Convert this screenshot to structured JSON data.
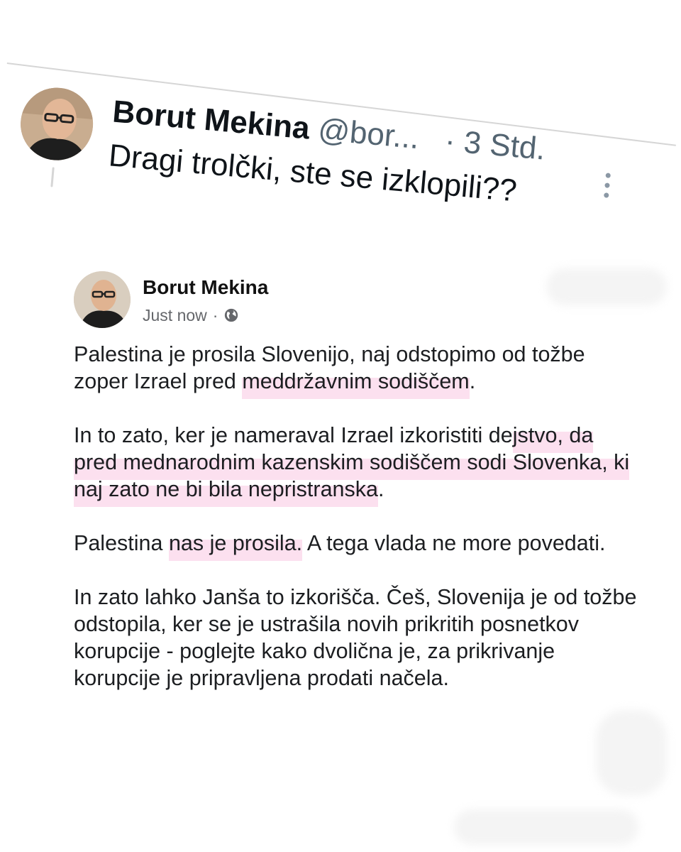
{
  "tweet": {
    "author_name": "Borut Mekina",
    "author_handle": "@bor...",
    "time": "· 3 Std.",
    "text": "Dragi trolčki, ste se izklopili??",
    "avatar_icon": "avatar-photo",
    "more_icon": "more-vertical-icon"
  },
  "post": {
    "author_name": "Borut Mekina",
    "timestamp": "Just now",
    "separator": "·",
    "audience_icon": "globe-icon",
    "paragraphs": [
      {
        "p1_a": "Palestina je prosila Slovenijo, naj odstopimo od tožbe zoper Izrael pred ",
        "p1_hl": "meddržavnim sodiščem",
        "p1_b": "."
      },
      {
        "p2_a": "In to zato, ker je nameraval Izrael izkoristiti de",
        "p2_hl": "jstvo, da pred mednarodnim kazenskim sodiščem sodi Slovenka, ki naj zato ne bi bila nepristranska",
        "p2_b": "."
      },
      {
        "p3_a": "Palestina ",
        "p3_hl": "nas je prosila.",
        "p3_b": " A tega vlada ne more povedati."
      },
      {
        "p4": "In zato lahko Janša to izkorišča. Češ, Slovenija je od tožbe odstopila, ker se je ustrašila novih prikritih posnetkov korupcije - poglejte kako dvolična je, za prikrivanje korupcije je pripravljena prodati načela."
      }
    ]
  },
  "colors": {
    "highlight": "#fce0ef",
    "meta_gray": "#65676b",
    "twitter_gray": "#536471"
  }
}
